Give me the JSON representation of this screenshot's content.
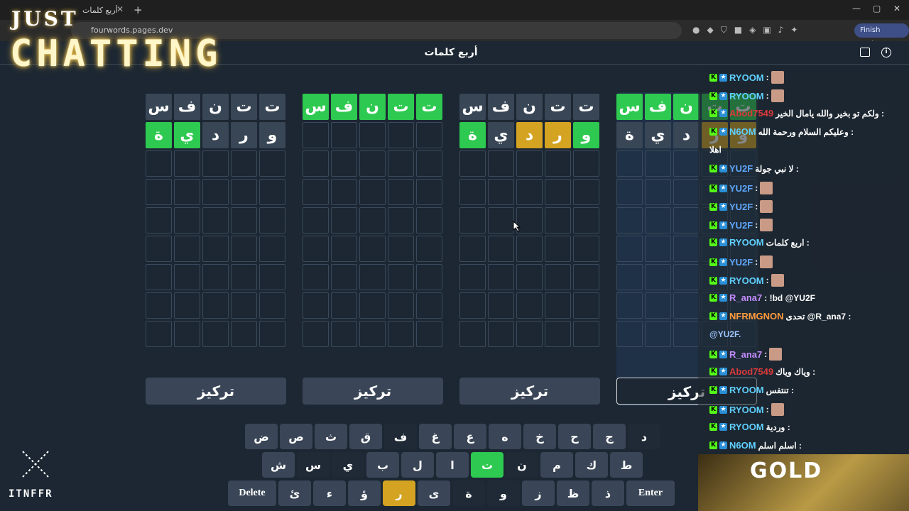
{
  "browser": {
    "tab_title": "أربع كلمات",
    "tab_close": "✕",
    "new_tab": "+",
    "url": "fourwords.pages.dev",
    "finish_update": "Finish update",
    "window_controls": [
      "—",
      "▢",
      "✕"
    ]
  },
  "header": {
    "title": "أربع كلمات",
    "calendar_icon": "calendar-icon",
    "info_icon": "i"
  },
  "boards": [
    {
      "rows": [
        {
          "letters": [
            "ت",
            "ت",
            "ن",
            "ف",
            "س"
          ],
          "states": [
            "green",
            "green",
            "green",
            "green",
            "green"
          ]
        },
        {
          "letters": [
            "و",
            "ر",
            "د",
            "ي",
            "ة"
          ],
          "states": [
            "yellow",
            "yellow",
            "filled",
            "filled",
            "filled"
          ]
        }
      ],
      "focus_label": "تركيز",
      "selected": true
    },
    {
      "rows": [
        {
          "letters": [
            "ت",
            "ت",
            "ن",
            "ف",
            "س"
          ],
          "states": [
            "filled",
            "filled",
            "filled",
            "filled",
            "filled"
          ]
        },
        {
          "letters": [
            "و",
            "ر",
            "د",
            "ي",
            "ة"
          ],
          "states": [
            "green",
            "yellow",
            "yellow",
            "filled",
            "green"
          ]
        }
      ],
      "focus_label": "تركيز",
      "selected": false
    },
    {
      "rows": [
        {
          "letters": [
            "ت",
            "ت",
            "ن",
            "ف",
            "س"
          ],
          "states": [
            "green",
            "green",
            "green",
            "green",
            "green"
          ]
        },
        {
          "letters": [
            "",
            "",
            "",
            "",
            ""
          ],
          "states": [
            "empty",
            "empty",
            "empty",
            "empty",
            "empty"
          ]
        }
      ],
      "focus_label": "تركيز",
      "selected": false
    },
    {
      "rows": [
        {
          "letters": [
            "ت",
            "ت",
            "ن",
            "ف",
            "س"
          ],
          "states": [
            "filled",
            "filled",
            "filled",
            "filled",
            "filled"
          ]
        },
        {
          "letters": [
            "و",
            "ر",
            "د",
            "ي",
            "ة"
          ],
          "states": [
            "filled",
            "filled",
            "filled",
            "green",
            "green"
          ]
        }
      ],
      "focus_label": "تركيز",
      "selected": false
    }
  ],
  "keyboard": {
    "row1": [
      {
        "label": "د",
        "state": "dark"
      },
      {
        "label": "ج",
        "state": ""
      },
      {
        "label": "ح",
        "state": ""
      },
      {
        "label": "خ",
        "state": ""
      },
      {
        "label": "ه",
        "state": ""
      },
      {
        "label": "ع",
        "state": ""
      },
      {
        "label": "غ",
        "state": ""
      },
      {
        "label": "ف",
        "state": "dark"
      },
      {
        "label": "ق",
        "state": ""
      },
      {
        "label": "ث",
        "state": ""
      },
      {
        "label": "ص",
        "state": ""
      },
      {
        "label": "ض",
        "state": ""
      }
    ],
    "row2": [
      {
        "label": "ط",
        "state": ""
      },
      {
        "label": "ك",
        "state": ""
      },
      {
        "label": "م",
        "state": ""
      },
      {
        "label": "ن",
        "state": "dark"
      },
      {
        "label": "ت",
        "state": "green"
      },
      {
        "label": "ا",
        "state": ""
      },
      {
        "label": "ل",
        "state": ""
      },
      {
        "label": "ب",
        "state": ""
      },
      {
        "label": "ي",
        "state": "dark"
      },
      {
        "label": "س",
        "state": "dark"
      },
      {
        "label": "ش",
        "state": ""
      }
    ],
    "row3": [
      {
        "label": "Enter",
        "state": ""
      },
      {
        "label": "ذ",
        "state": ""
      },
      {
        "label": "ظ",
        "state": ""
      },
      {
        "label": "ز",
        "state": ""
      },
      {
        "label": "و",
        "state": "dark"
      },
      {
        "label": "ة",
        "state": "dark"
      },
      {
        "label": "ى",
        "state": ""
      },
      {
        "label": "ر",
        "state": "yellow"
      },
      {
        "label": "ؤ",
        "state": ""
      },
      {
        "label": "ء",
        "state": ""
      },
      {
        "label": "ئ",
        "state": ""
      },
      {
        "label": "Delete",
        "state": ""
      }
    ]
  },
  "chat": [
    {
      "user": "RYOOM",
      "text": ":",
      "color": "#5fd0ff",
      "avatar": true
    },
    {
      "user": "RYOOM",
      "text": ":",
      "color": "#5fd0ff",
      "avatar": true
    },
    {
      "user": "Abod7549",
      "text": "ولكم تو بخير والله يامال الخير :",
      "color": "#d93a3a",
      "avatar": false
    },
    {
      "user": "N6OM",
      "text": "وعليكم السلام ورحمة الله :",
      "color": "#5fd0ff",
      "avatar": false
    },
    {
      "user": "",
      "text": "اهلا",
      "color": "#ffffff",
      "avatar": false
    },
    {
      "user": "YU2F",
      "text": "لا نبي جولة :",
      "color": "#5fa8ff",
      "avatar": false
    },
    {
      "user": "YU2F",
      "text": ":",
      "color": "#5fa8ff",
      "avatar": true
    },
    {
      "user": "YU2F",
      "text": ":",
      "color": "#5fa8ff",
      "avatar": true
    },
    {
      "user": "YU2F",
      "text": ":",
      "color": "#5fa8ff",
      "avatar": true
    },
    {
      "user": "RYOOM",
      "text": "اربع كلمات :",
      "color": "#5fd0ff",
      "avatar": false
    },
    {
      "user": "YU2F",
      "text": ":",
      "color": "#5fa8ff",
      "avatar": true
    },
    {
      "user": "RYOOM",
      "text": ":",
      "color": "#5fd0ff",
      "avatar": true
    },
    {
      "user": "R_ana7",
      "text": ": !bd @YU2F",
      "color": "#c48cff",
      "avatar": false
    },
    {
      "user": "NFRMGNON",
      "text": "تحدى @R_ana7 :",
      "color": "#ff9b3d",
      "avatar": false
    },
    {
      "user": "",
      "text": "@YU2F.",
      "color": "#9ec5ff",
      "avatar": false
    },
    {
      "user": "R_ana7",
      "text": ":",
      "color": "#c48cff",
      "avatar": true
    },
    {
      "user": "Abod7549",
      "text": "وياك وياك :",
      "color": "#d93a3a",
      "avatar": false
    },
    {
      "user": "RYOOM",
      "text": "تنتفس :",
      "color": "#5fd0ff",
      "avatar": false
    },
    {
      "user": "RYOOM",
      "text": ":",
      "color": "#5fd0ff",
      "avatar": true
    },
    {
      "user": "RYOOM",
      "text": "وردية :",
      "color": "#5fd0ff",
      "avatar": false
    },
    {
      "user": "N6OM",
      "text": "اسلم اسلم :",
      "color": "#5fd0ff",
      "avatar": false
    }
  ],
  "overlay": {
    "just": "JUST",
    "chatting": "CHATTING",
    "logo_text": "ITNFFR",
    "gold": "GOLD"
  },
  "colors": {
    "green": "#2ec950",
    "yellow": "#d4a321",
    "tile": "#384656",
    "background": "#1c2733"
  }
}
